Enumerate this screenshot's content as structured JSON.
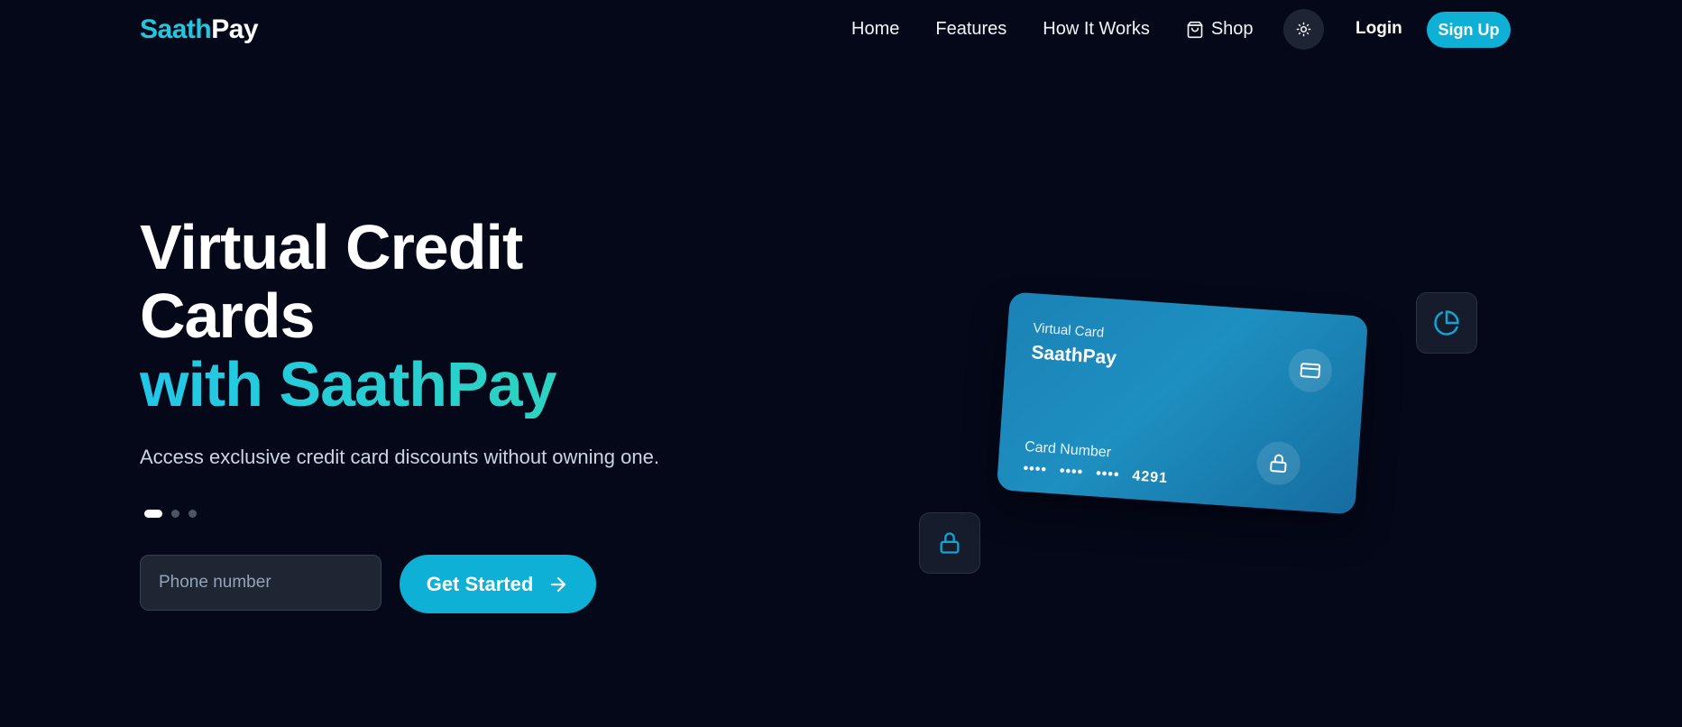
{
  "brand": {
    "name_part1": "Saath",
    "name_part2": "Pay"
  },
  "nav": {
    "links": [
      {
        "label": "Home"
      },
      {
        "label": "Features"
      },
      {
        "label": "How It Works"
      },
      {
        "label": "Shop",
        "icon": "shopping-bag-icon"
      }
    ],
    "theme_toggle_icon": "sun-icon",
    "login_label": "Login",
    "signup_label": "Sign Up"
  },
  "hero": {
    "title_line1": "Virtual Credit",
    "title_line2": "Cards",
    "title_accent": "with SaathPay",
    "subtitle": "Access exclusive credit card discounts without owning one.",
    "carousel": {
      "total": 3,
      "active_index": 0
    },
    "phone_placeholder": "Phone number",
    "phone_value": "",
    "cta_label": "Get Started",
    "cta_icon": "arrow-right-icon"
  },
  "card": {
    "label": "Virtual Card",
    "brand": "SaathPay",
    "number_label": "Card Number",
    "masked_groups": [
      "••••",
      "••••",
      "••••"
    ],
    "last4": "4291",
    "icons": [
      "credit-card-icon",
      "lock-icon"
    ]
  },
  "floating_tiles": [
    {
      "icon": "pie-chart-icon"
    },
    {
      "icon": "lock-icon"
    }
  ],
  "colors": {
    "background": "#040818",
    "accent": "#0eb0d6",
    "brand_cyan": "#22c7de",
    "card_blue": "#1b82b6"
  }
}
